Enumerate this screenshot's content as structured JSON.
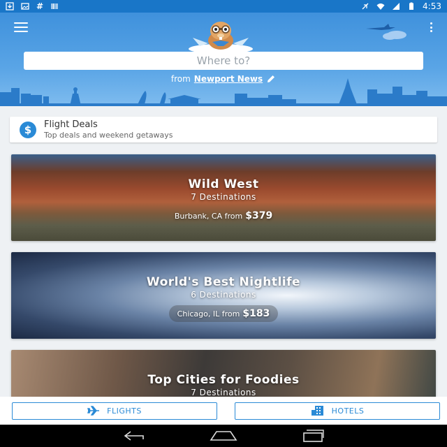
{
  "status_bar": {
    "time": "4:53"
  },
  "header": {
    "search_placeholder": "Where to?",
    "from_label": "from",
    "from_city": "Newport News"
  },
  "flight_deals": {
    "title": "Flight Deals",
    "subtitle": "Top deals and weekend getaways"
  },
  "destinations": [
    {
      "title": "Wild West",
      "count": "7 Destinations",
      "from_text": "Burbank, CA from",
      "price": "$379"
    },
    {
      "title": "World's Best Nightlife",
      "count": "6 Destinations",
      "from_text": "Chicago, IL from",
      "price": "$183"
    },
    {
      "title": "Top Cities for Foodies",
      "count": "7 Destinations"
    }
  ],
  "tabs": {
    "flights": "FLIGHTS",
    "hotels": "HOTELS"
  },
  "colors": {
    "brand_blue": "#2a8ad6",
    "status_bar": "#1976c8"
  },
  "icons": [
    "menu-icon",
    "overflow-icon",
    "edit-icon",
    "dollar-icon",
    "plane-icon",
    "hotel-icon",
    "back-icon",
    "home-icon",
    "recents-icon"
  ]
}
